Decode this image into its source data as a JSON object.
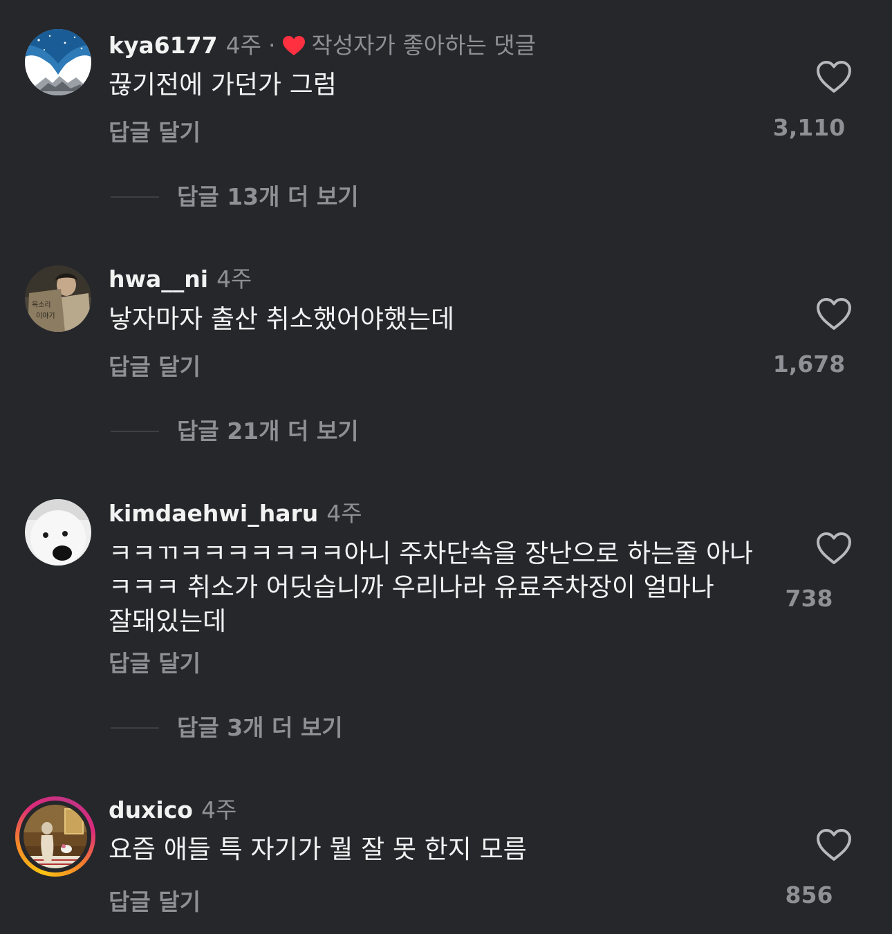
{
  "comments": [
    {
      "username": "kya6177",
      "time": "4주",
      "separator": "·",
      "liked_by_author": "작성자가 좋아하는 댓글",
      "text": [
        "끊기전에 가던가 그럼"
      ],
      "reply_label": "답글 달기",
      "like_count": "3,110",
      "more_replies": "답글 13개 더 보기",
      "avatar_icon": "avatar-image"
    },
    {
      "username": "hwa__ni",
      "time": "4주",
      "text": [
        "낳자마자 출산 취소했어야했는데"
      ],
      "reply_label": "답글 달기",
      "like_count": "1,678",
      "more_replies": "답글 21개 더 보기",
      "avatar_icon": "avatar-image"
    },
    {
      "username": "kimdaehwi_haru",
      "time": "4주",
      "text": [
        "ㅋㅋㄲㅋㅋㅋㅋㅋㅋㅋ아니 주차단속을 장난으로 하는줄 아나",
        "ㅋㅋㅋ 취소가 어딧습니까 우리나라 유료주차장이 얼마나",
        "잘돼있는데"
      ],
      "reply_label": "답글 달기",
      "like_count": "738",
      "more_replies": "답글 3개 더 보기",
      "avatar_icon": "avatar-image"
    },
    {
      "username": "duxico",
      "time": "4주",
      "text": [
        "요즘 애들 특 자기가 뭘 잘 못 한지 모름"
      ],
      "reply_label": "답글 달기",
      "like_count": "856",
      "avatar_icon": "avatar-image-story-ring"
    }
  ],
  "colors": {
    "background": "#25272b",
    "primary_text": "#f2f2f2",
    "secondary_text": "#8e9095",
    "liked_heart": "#ff3040"
  }
}
